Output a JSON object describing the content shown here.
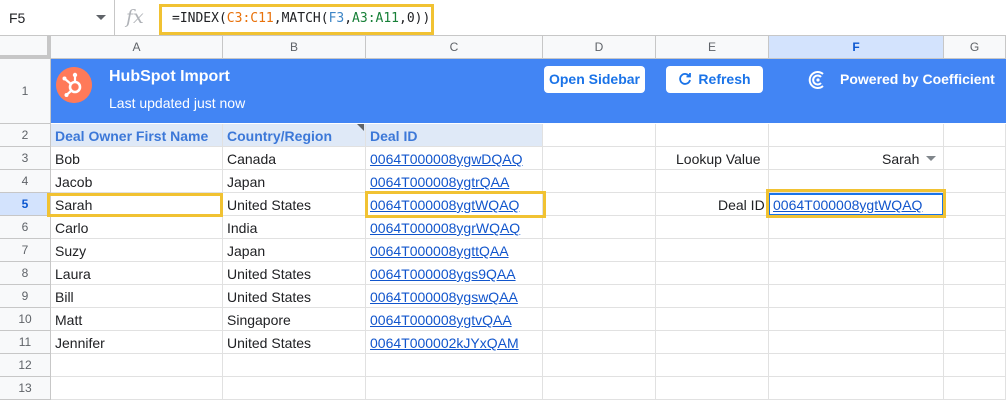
{
  "formula_bar": {
    "cell_ref": "F5",
    "fx_label": "fx",
    "formula_parts": [
      {
        "text": "=INDEX(",
        "color": "default"
      },
      {
        "text": "C3:C11",
        "color": "orange"
      },
      {
        "text": ",MATCH(",
        "color": "default"
      },
      {
        "text": "F3",
        "color": "blue"
      },
      {
        "text": ",",
        "color": "default"
      },
      {
        "text": "A3:A11",
        "color": "green"
      },
      {
        "text": ",0))",
        "color": "default"
      }
    ]
  },
  "columns": [
    "A",
    "B",
    "C",
    "D",
    "E",
    "F",
    "G"
  ],
  "rows": [
    "1",
    "2",
    "3",
    "4",
    "5",
    "6",
    "7",
    "8",
    "9",
    "10",
    "11",
    "12",
    "13"
  ],
  "selected_column": "F",
  "selected_row": "5",
  "banner": {
    "title": "HubSpot Import",
    "subtitle": "Last updated just now",
    "open_sidebar": "Open Sidebar",
    "refresh": "Refresh",
    "powered_by": "Powered by Coefficient",
    "logo_icon": "hubspot-sprocket-icon",
    "brand_color": "#4285f4"
  },
  "table": {
    "headers": [
      "Deal Owner First Name",
      "Country/Region",
      "Deal ID"
    ],
    "rows": [
      [
        "Bob",
        "Canada",
        "0064T000008ygwDQAQ"
      ],
      [
        "Jacob",
        "Japan",
        "0064T000008ygtrQAA"
      ],
      [
        "Sarah",
        "United States",
        "0064T000008ygtWQAQ"
      ],
      [
        "Carlo",
        "India",
        "0064T000008ygrWQAQ"
      ],
      [
        "Suzy",
        "Japan",
        "0064T000008ygttQAA"
      ],
      [
        "Laura",
        "United States",
        "0064T000008ygs9QAA"
      ],
      [
        "Bill",
        "United States",
        "0064T000008ygswQAA"
      ],
      [
        "Matt",
        "Singapore",
        "0064T000008ygtvQAA"
      ],
      [
        "Jennifer",
        "United States",
        "0064T000002kJYxQAM"
      ]
    ]
  },
  "lookup": {
    "label": "Lookup Value",
    "value": "Sarah",
    "result_label": "Deal ID",
    "result_value": "0064T000008ygtWQAQ"
  },
  "highlight_color": "#f1c232"
}
